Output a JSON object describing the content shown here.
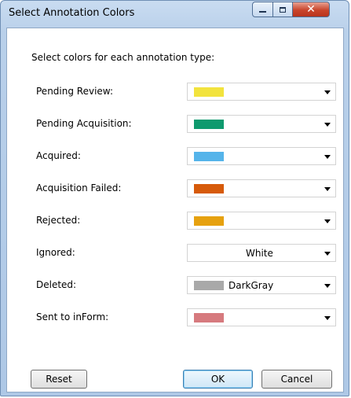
{
  "window": {
    "title": "Select Annotation Colors"
  },
  "instructions": "Select colors for each annotation type:",
  "rows": [
    {
      "label": "Pending Review:",
      "color_name": "",
      "swatch": "#f2e33d"
    },
    {
      "label": "Pending Acquisition:",
      "color_name": "",
      "swatch": "#0e9a6e"
    },
    {
      "label": "Acquired:",
      "color_name": "",
      "swatch": "#55b4ea"
    },
    {
      "label": "Acquisition Failed:",
      "color_name": "",
      "swatch": "#d65a0a"
    },
    {
      "label": "Rejected:",
      "color_name": "",
      "swatch": "#e6a10f"
    },
    {
      "label": "Ignored:",
      "color_name": "White",
      "swatch": "#ffffff"
    },
    {
      "label": "Deleted:",
      "color_name": "DarkGray",
      "swatch": "#a9a9a9"
    },
    {
      "label": "Sent to inForm:",
      "color_name": "",
      "swatch": "#d67a7e"
    }
  ],
  "buttons": {
    "reset": "Reset",
    "ok": "OK",
    "cancel": "Cancel"
  }
}
